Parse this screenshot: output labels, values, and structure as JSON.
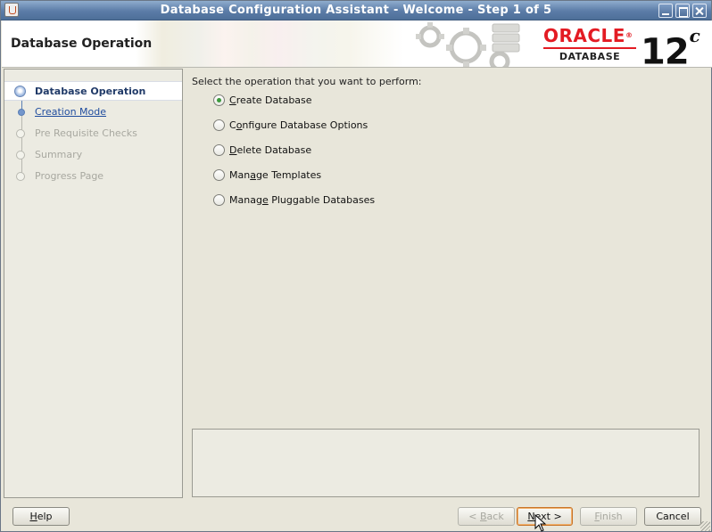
{
  "window": {
    "title": "Database Configuration Assistant - Welcome - Step 1 of 5",
    "app_icon": "java-cup-icon",
    "controls": [
      "minimize-icon",
      "maximize-icon",
      "close-icon"
    ]
  },
  "header": {
    "page_title": "Database Operation",
    "logo": {
      "brand": "ORACLE",
      "registered": "®",
      "product": "DATABASE",
      "version": "12",
      "version_suffix": "c"
    },
    "colors": {
      "oracle_red": "#e31b23"
    }
  },
  "nav": {
    "items": [
      {
        "label": "Database Operation",
        "state": "current"
      },
      {
        "label": "Creation Mode",
        "state": "link"
      },
      {
        "label": "Pre Requisite Checks",
        "state": "disabled"
      },
      {
        "label": "Summary",
        "state": "disabled"
      },
      {
        "label": "Progress Page",
        "state": "disabled"
      }
    ]
  },
  "main": {
    "prompt": "Select the operation that you want to perform:",
    "options": [
      {
        "mnemonic": "C",
        "rest": "reate Database",
        "pre": "",
        "selected": true
      },
      {
        "pre": "C",
        "mnemonic": "o",
        "rest": "nfigure Database Options",
        "selected": false
      },
      {
        "mnemonic": "D",
        "rest": "elete Database",
        "pre": "",
        "selected": false
      },
      {
        "pre": "Man",
        "mnemonic": "a",
        "rest": "ge Templates",
        "selected": false
      },
      {
        "pre": "Manag",
        "mnemonic": "e",
        "rest": " Pluggable Databases",
        "selected": false
      }
    ]
  },
  "buttons": {
    "help": {
      "mnemonic": "H",
      "rest": "elp"
    },
    "back": {
      "pre": "< ",
      "mnemonic": "B",
      "rest": "ack",
      "enabled": false
    },
    "next": {
      "mnemonic": "N",
      "rest": "ext >",
      "enabled": true,
      "default": true
    },
    "finish": {
      "mnemonic": "F",
      "rest": "inish",
      "enabled": false
    },
    "cancel": {
      "label": "Cancel"
    }
  }
}
